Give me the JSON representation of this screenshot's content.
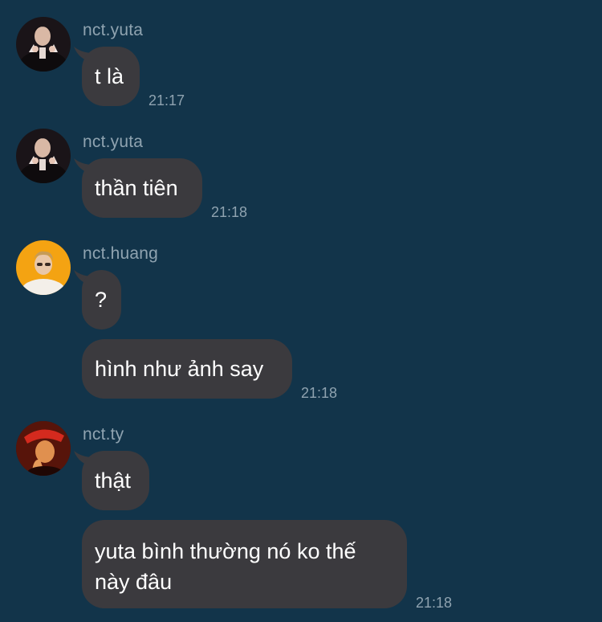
{
  "messages": [
    {
      "sender": "nct.yuta",
      "avatar": "yuta-avatar",
      "text": "t là",
      "time": "21:17"
    },
    {
      "sender": "nct.yuta",
      "avatar": "yuta-avatar",
      "text": "thần tiên",
      "time": "21:18"
    },
    {
      "sender": "nct.huang",
      "avatar": "huang-avatar",
      "text": "?",
      "time": ""
    },
    {
      "sender": "",
      "avatar": "",
      "text": "hình như ảnh say",
      "time": "21:18"
    },
    {
      "sender": "nct.ty",
      "avatar": "ty-avatar",
      "text": "thật",
      "time": ""
    },
    {
      "sender": "",
      "avatar": "",
      "text": "yuta bình thường nó ko thế này đâu",
      "time": "21:18"
    }
  ],
  "colors": {
    "background": "#12344a",
    "bubble": "#3b3a3e",
    "text": "#ffffff",
    "meta": "#8fa3b0"
  }
}
